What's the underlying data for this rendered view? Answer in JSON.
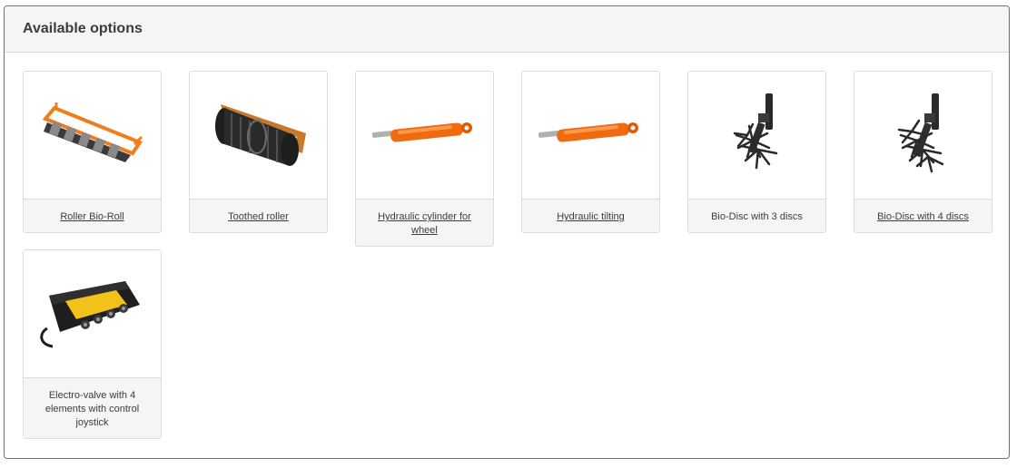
{
  "panel": {
    "title": "Available options"
  },
  "options": [
    {
      "label": "Roller Bio-Roll",
      "linked": true,
      "icon": "roller-bio-roll-image"
    },
    {
      "label": "Toothed roller",
      "linked": true,
      "icon": "toothed-roller-image"
    },
    {
      "label": "Hydraulic cylinder for wheel",
      "linked": true,
      "icon": "hydraulic-cylinder-image"
    },
    {
      "label": "Hydraulic tilting",
      "linked": true,
      "icon": "hydraulic-tilting-image"
    },
    {
      "label": "Bio-Disc with 3 discs",
      "linked": false,
      "icon": "bio-disc-3-image"
    },
    {
      "label": "Bio-Disc with 4 discs",
      "linked": true,
      "icon": "bio-disc-4-image"
    },
    {
      "label": "Electro-valve with 4 elements with control joystick",
      "linked": false,
      "icon": "electro-valve-image"
    }
  ],
  "colors": {
    "accent": "#f07d1a",
    "dark": "#2a2a2a"
  }
}
